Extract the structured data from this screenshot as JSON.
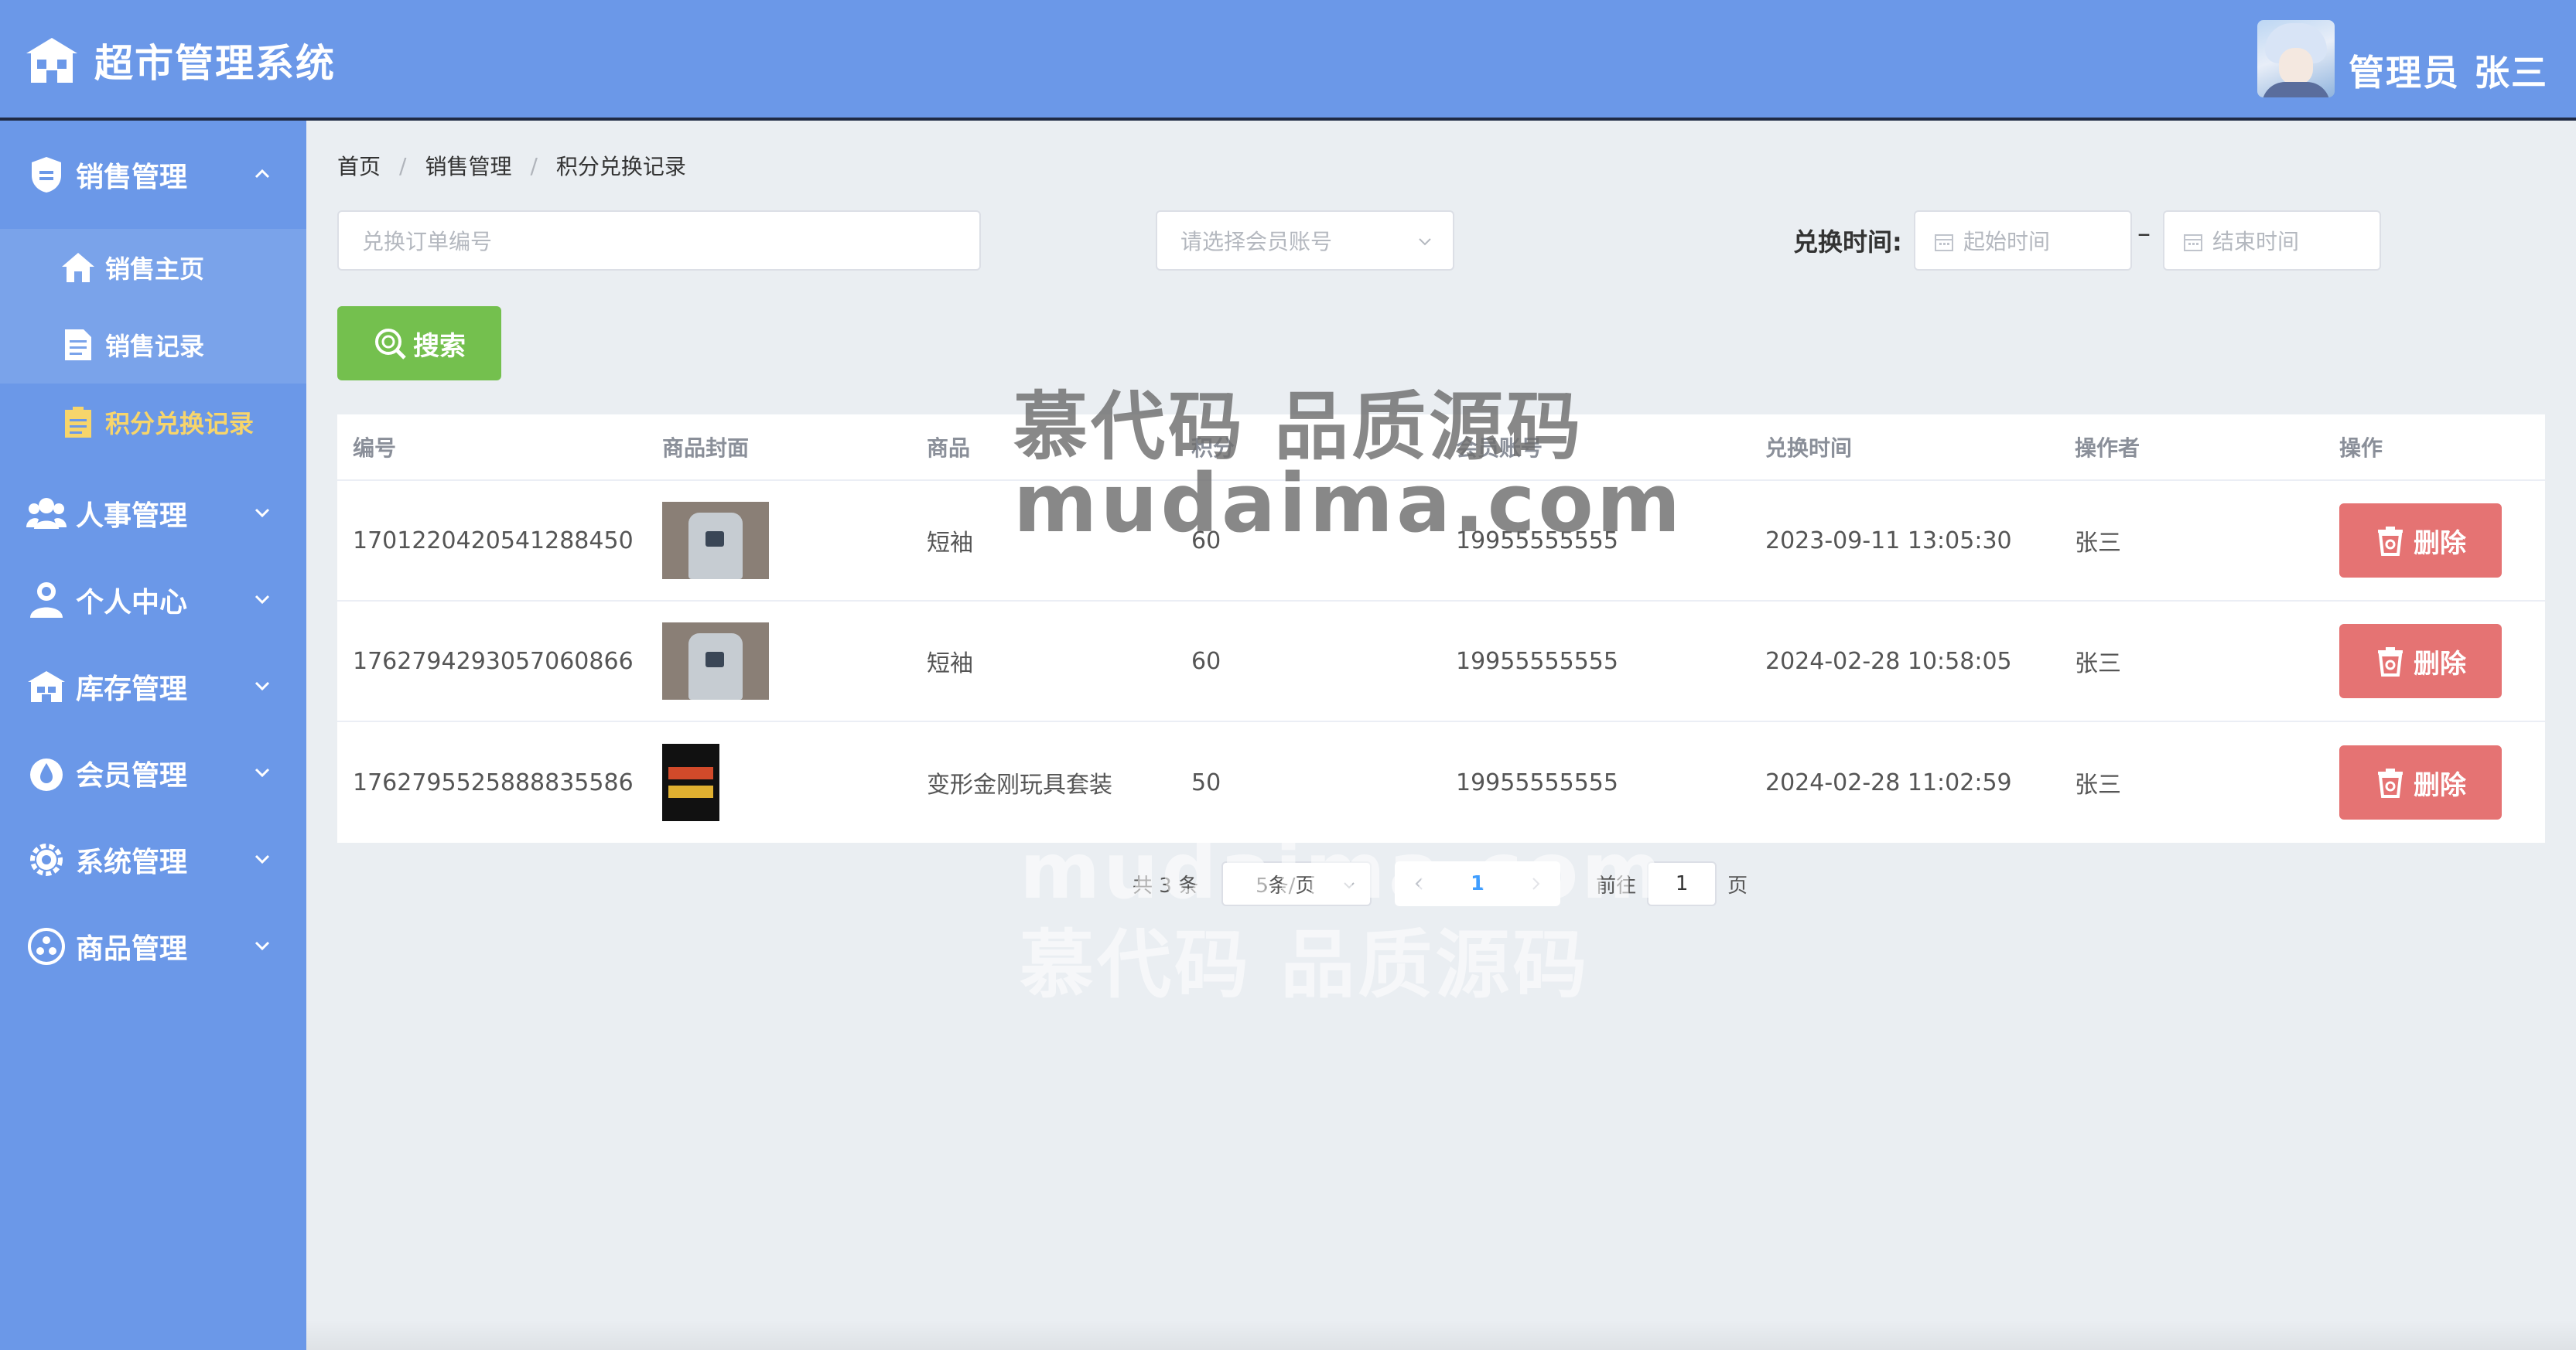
{
  "header": {
    "title": "超市管理系统",
    "user_label": "管理员 张三"
  },
  "sidebar": {
    "items": [
      {
        "label": "销售管理",
        "icon": "shield-icon",
        "expanded": true,
        "children": [
          {
            "label": "销售主页",
            "icon": "home-icon"
          },
          {
            "label": "销售记录",
            "icon": "document-icon"
          },
          {
            "label": "积分兑换记录",
            "icon": "clipboard-icon",
            "active": true
          }
        ]
      },
      {
        "label": "人事管理",
        "icon": "people-icon"
      },
      {
        "label": "个人中心",
        "icon": "user-icon"
      },
      {
        "label": "库存管理",
        "icon": "warehouse-icon"
      },
      {
        "label": "会员管理",
        "icon": "drop-icon"
      },
      {
        "label": "系统管理",
        "icon": "gear-icon"
      },
      {
        "label": "商品管理",
        "icon": "product-icon"
      }
    ]
  },
  "breadcrumb": [
    "首页",
    "销售管理",
    "积分兑换记录"
  ],
  "filters": {
    "order_placeholder": "兑换订单编号",
    "member_placeholder": "请选择会员账号",
    "date_label": "兑换时间:",
    "start_placeholder": "起始时间",
    "end_placeholder": "结束时间",
    "dash": "–",
    "search_label": "搜索"
  },
  "table": {
    "headers": [
      "编号",
      "商品封面",
      "商品",
      "积分",
      "会员账号",
      "兑换时间",
      "操作者",
      "操作"
    ],
    "rows": [
      {
        "id": "1701220420541288450",
        "cover": "shirt",
        "name": "短袖",
        "points": "60",
        "account": "19955555555",
        "time": "2023-09-11 13:05:30",
        "operator": "张三",
        "action": "删除"
      },
      {
        "id": "1762794293057060866",
        "cover": "shirt",
        "name": "短袖",
        "points": "60",
        "account": "19955555555",
        "time": "2024-02-28 10:58:05",
        "operator": "张三",
        "action": "删除"
      },
      {
        "id": "1762795525888835586",
        "cover": "toy",
        "name": "变形金刚玩具套装",
        "points": "50",
        "account": "19955555555",
        "time": "2024-02-28 11:02:59",
        "operator": "张三",
        "action": "删除"
      }
    ]
  },
  "pagination": {
    "total": "共 3 条",
    "page_size": "5条/页",
    "current": "1",
    "goto_label": "前往",
    "goto_value": "1",
    "page_suffix": "页"
  },
  "watermark": {
    "line1": "慕代码 品质源码",
    "line2": "mudaima.com"
  },
  "colors": {
    "brand": "#6b98e8",
    "active_menu_text": "#f7d56b",
    "search_button": "#74c04e",
    "delete_button": "#e57373",
    "page_active": "#409eff"
  }
}
